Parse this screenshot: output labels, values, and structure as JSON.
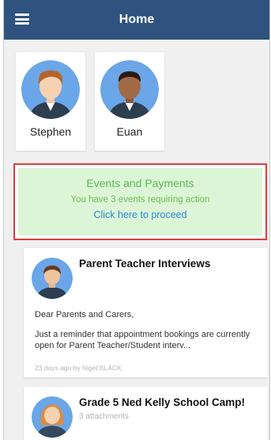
{
  "header": {
    "title": "Home",
    "menu_icon": "hamburger-menu-icon",
    "bg_color": "#2f527f"
  },
  "children": [
    {
      "name": "Stephen",
      "avatar": "boy-avatar"
    },
    {
      "name": "Euan",
      "avatar": "boy-avatar-dark"
    }
  ],
  "alert": {
    "title": "Events and Payments",
    "subtitle": "You have 3 events requiring action",
    "link": "Click here to proceed",
    "border_color": "#e53a3a",
    "bg_color": "#ddf5d7"
  },
  "posts": [
    {
      "title": "Parent Teacher Interviews",
      "greeting": "Dear Parents and Carers,",
      "body": "Just a reminder that appointment bookings are currently open for Parent Teacher/Student interv...",
      "footer": "23 days ago by Nigel BLACK",
      "avatar": "man-avatar"
    },
    {
      "title": "Grade 5 Ned Kelly School Camp!",
      "meta": "3 attachments",
      "avatar": "woman-avatar"
    }
  ]
}
